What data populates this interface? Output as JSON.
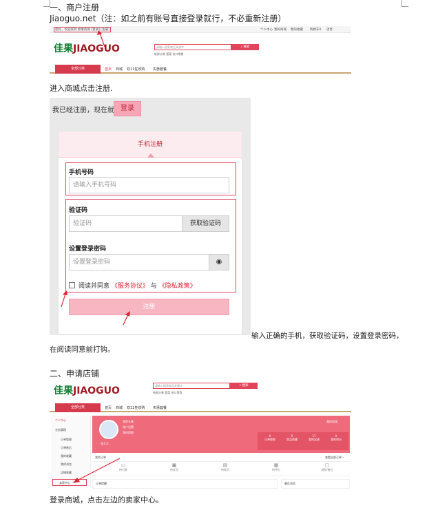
{
  "section1": {
    "heading": "一、商户注册",
    "line": "Jiaoguo.net（注：如之前有账号直接登录就行，不必重新注册）"
  },
  "site": {
    "welcome": "您好，欢迎来到 娇果商城 [登录] [注册]",
    "top_links": [
      "个人中心",
      "我的商城",
      "我的收藏",
      "购物车0",
      "消息"
    ],
    "logo_cn": "佳果",
    "logo_en": "JIAOGUO",
    "search_placeholder": "请输入搜索商品关键字 · · ·",
    "search_button": "搜索",
    "hot_words": "新鲜水果  蔬菜  进口零食",
    "category_button": "全部分类",
    "nav": [
      "首页",
      "商城",
      "双11狂欢购",
      "实惠套餐"
    ]
  },
  "caption1": "进入商城点击注册.",
  "register": {
    "already_text": "我已经注册，现在就",
    "login_button": "登录",
    "tab": "手机注册",
    "phone_label": "手机号码",
    "phone_placeholder": "请输入手机号码",
    "code_label": "验证码",
    "code_placeholder": "验证码",
    "code_button": "获取验证码",
    "pwd_label": "设置登录密码",
    "pwd_placeholder": "设置登录密码",
    "eye_icon": "eye-icon",
    "agree_prefix": "阅读并同意",
    "agree_service": "《服务协议》",
    "agree_and": "与",
    "agree_privacy": "《隐私政策》",
    "submit": "注册"
  },
  "caption2a": "输入正确的手机，获取验证码，设置登录密码，",
  "caption2b": "在阅读同意前打钩。",
  "section2": {
    "heading": "二、申请店铺"
  },
  "member": {
    "sidebar": [
      "个人中心",
      "业务管理",
      "订单管理",
      "订单售后",
      "我的收藏",
      "我的浏览",
      "店铺收藏",
      "卖家中心"
    ],
    "user_lines": [
      "我的头像",
      "账户设置",
      "我的团购"
    ],
    "user_name": "张大大",
    "badge": "我的商城",
    "stats": [
      {
        "num": "0",
        "label": "订单收款"
      },
      {
        "num": "0",
        "label": "商品收藏"
      },
      {
        "num": "17",
        "label": "我的足迹"
      },
      {
        "num": "0",
        "label": "我的积分"
      }
    ],
    "section_title": "我的订单",
    "view_all": "查看全部订单 ›",
    "order_tabs": [
      "待付款",
      "待发货",
      "待收货",
      "待评价",
      "退款/售后"
    ],
    "panel_left": "订单提醒",
    "panel_right": "最近浏览"
  },
  "caption3": "登录商城，点击左边的卖家中心。",
  "colors": {
    "accent": "#e0445b",
    "brand_red": "#a01822",
    "brand_green": "#0b7d2e"
  }
}
